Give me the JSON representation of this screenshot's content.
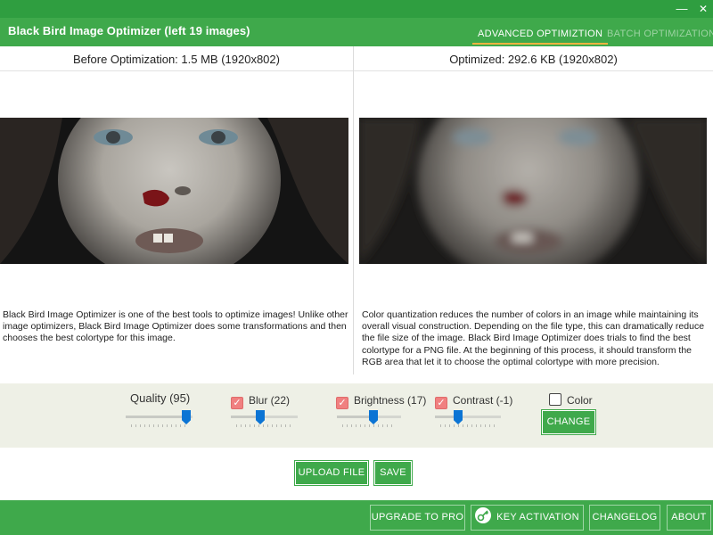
{
  "window": {
    "minimize_glyph": "—",
    "close_glyph": "✕"
  },
  "header": {
    "title": "Black Bird Image Optimizer (left 19 images)",
    "tabs": [
      {
        "label": "ADVANCED OPTIMIZTION",
        "active": true
      },
      {
        "label": "BATCH OPTIMIZATION",
        "active": false
      }
    ]
  },
  "before": {
    "heading": "Before Optimization: 1.5 MB (1920x802)",
    "description": "Black Bird Image Optimizer is one of the best tools to optimize images! Unlike other image optimizers, Black Bird Image Optimizer does some transformations and then chooses the best colortype for this image."
  },
  "after": {
    "heading": "Optimized: 292.6 KB (1920x802)",
    "description": "Color quantization reduces the number of colors in an image while maintaining its overall visual construction. Depending on the file type, this can dramatically reduce the file size of the image. Black Bird Image Optimizer does trials to find the best colortype for a PNG file. At the beginning of this process, it should transform the RGB area that let it to choose the optimal colortype with more precision."
  },
  "controls": {
    "quality": {
      "label": "Quality (95)",
      "value": 95
    },
    "blur": {
      "label": "Blur (22)",
      "checked": true,
      "value": 22
    },
    "brightness": {
      "label": "Brightness (17)",
      "checked": true,
      "value": 17
    },
    "contrast": {
      "label": "Contrast (-1)",
      "checked": true,
      "value": -1
    },
    "color": {
      "label": "Color",
      "checked": false
    },
    "change_label": "CHANGE"
  },
  "actions": {
    "upload_label": "UPLOAD FILE",
    "save_label": "SAVE"
  },
  "footer": {
    "upgrade_label": "UPGRADE TO PRO",
    "key_activation_label": "KEY ACTIVATION",
    "changelog_label": "CHANGELOG",
    "about_label": "ABOUT"
  },
  "colors": {
    "brand_green": "#3fa94b",
    "title_bar_green": "#2f9e40",
    "tab_underline": "#f3b240",
    "slider_thumb": "#0b74d4",
    "checkbox_checked": "#f08080",
    "controls_bg": "#eef0e6"
  },
  "icons": {
    "key_activation": "key-icon"
  }
}
